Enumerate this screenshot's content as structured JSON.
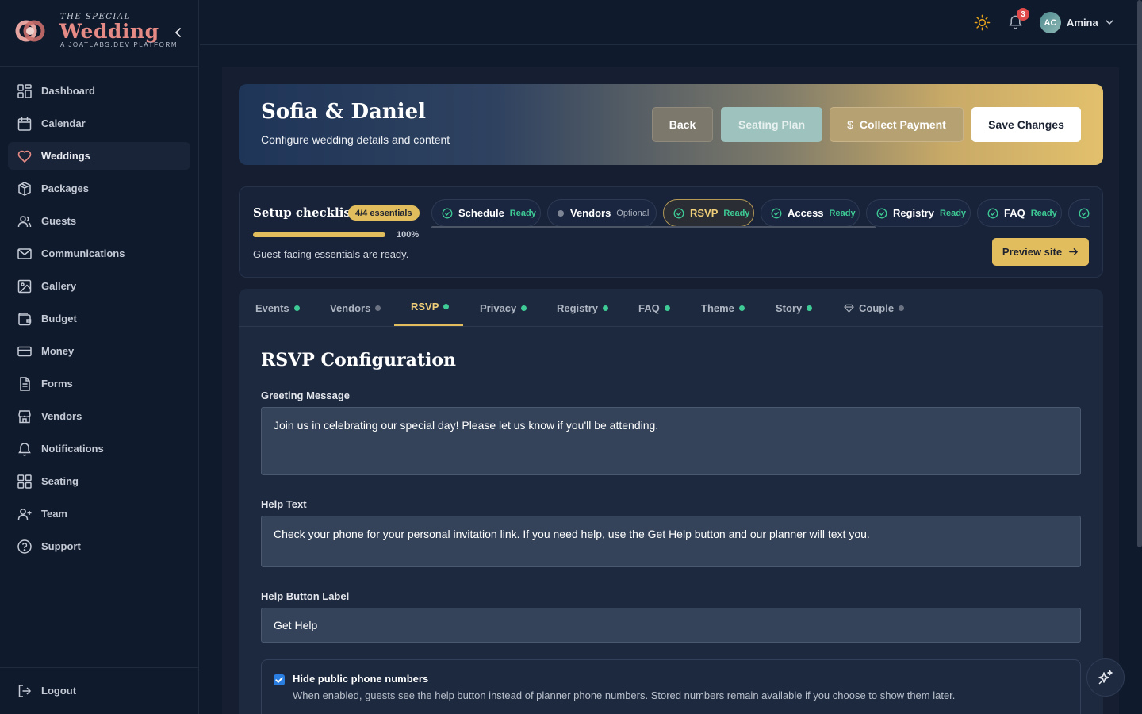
{
  "brand": {
    "top": "THE SPECIAL",
    "main": "Wedding",
    "sub": "A JOATLABS.DEV PLATFORM"
  },
  "nav": {
    "items": [
      {
        "label": "Dashboard",
        "icon": "grid-icon"
      },
      {
        "label": "Calendar",
        "icon": "calendar-icon"
      },
      {
        "label": "Weddings",
        "icon": "heart-icon",
        "active": true
      },
      {
        "label": "Packages",
        "icon": "package-icon"
      },
      {
        "label": "Guests",
        "icon": "users-icon"
      },
      {
        "label": "Communications",
        "icon": "mail-icon"
      },
      {
        "label": "Gallery",
        "icon": "image-icon"
      },
      {
        "label": "Budget",
        "icon": "wallet-icon"
      },
      {
        "label": "Money",
        "icon": "credit-card-icon"
      },
      {
        "label": "Forms",
        "icon": "file-icon"
      },
      {
        "label": "Vendors",
        "icon": "store-icon"
      },
      {
        "label": "Notifications",
        "icon": "bell-icon"
      },
      {
        "label": "Seating",
        "icon": "grid-icon"
      },
      {
        "label": "Team",
        "icon": "user-plus-icon"
      },
      {
        "label": "Support",
        "icon": "help-circle-icon"
      }
    ],
    "logout": "Logout"
  },
  "topbar": {
    "notification_count": "3",
    "avatar_initials": "AC",
    "user_name": "Amina"
  },
  "hero": {
    "title": "Sofia & Daniel",
    "subtitle": "Configure wedding details and content",
    "back": "Back",
    "seating_plan": "Seating Plan",
    "collect_payment_symbol": "$",
    "collect_payment": "Collect Payment",
    "save": "Save Changes"
  },
  "checklist": {
    "title": "Setup checklist",
    "badge": "4/4 essentials",
    "progress": 1.0,
    "progress_label": "100%",
    "message": "Guest-facing essentials are ready.",
    "preview_button": "Preview site",
    "pills": [
      {
        "name": "Schedule",
        "status": "Ready"
      },
      {
        "name": "Vendors",
        "status": "Optional"
      },
      {
        "name": "RSVP",
        "status": "Ready",
        "active": true
      },
      {
        "name": "Access",
        "status": "Ready"
      },
      {
        "name": "Registry",
        "status": "Ready"
      },
      {
        "name": "FAQ",
        "status": "Ready"
      }
    ]
  },
  "tabs": [
    {
      "label": "Events",
      "dot": "green"
    },
    {
      "label": "Vendors",
      "dot": "grey"
    },
    {
      "label": "RSVP",
      "dot": "green",
      "active": true
    },
    {
      "label": "Privacy",
      "dot": "green"
    },
    {
      "label": "Registry",
      "dot": "green"
    },
    {
      "label": "FAQ",
      "dot": "green"
    },
    {
      "label": "Theme",
      "dot": "green"
    },
    {
      "label": "Story",
      "dot": "green"
    },
    {
      "label": "Couple",
      "dot": "grey"
    }
  ],
  "rsvp": {
    "title": "RSVP Configuration",
    "greeting_label": "Greeting Message",
    "greeting_value": "Join us in celebrating our special day! Please let us know if you'll be attending.",
    "help_label": "Help Text",
    "help_value": "Check your phone for your personal invitation link. If you need help, use the Get Help button and our planner will text you.",
    "button_label_label": "Help Button Label",
    "button_label_value": "Get Help",
    "hide_phone_title": "Hide public phone numbers",
    "hide_phone_desc": "When enabled, guests see the help button instead of planner phone numbers. Stored numbers remain available if you choose to show them later.",
    "hide_phone_checked": true
  },
  "colors": {
    "accent_gold": "#e2bd5e",
    "ready_green": "#3ecb96",
    "brand_pink": "#e58a84",
    "background": "#0f1a2c"
  }
}
